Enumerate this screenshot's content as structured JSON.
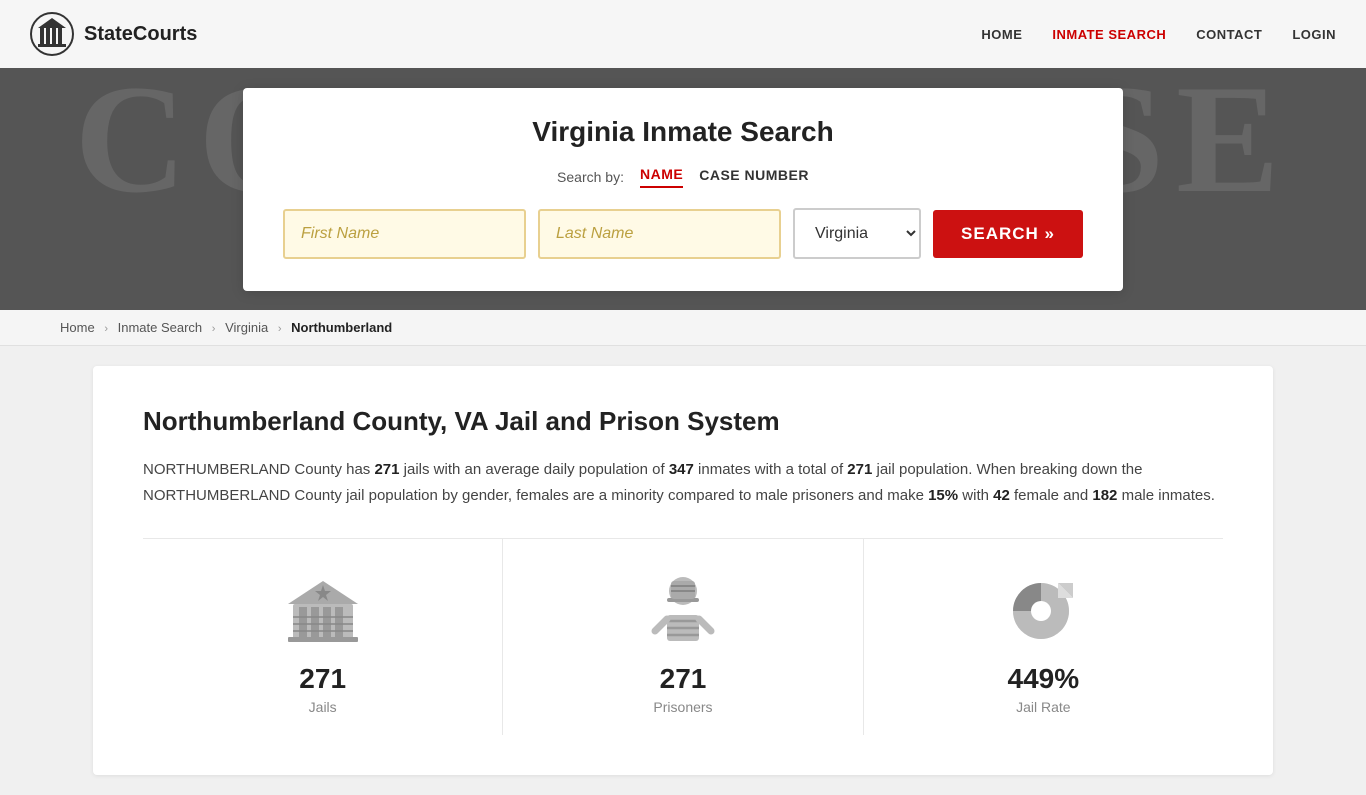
{
  "site": {
    "logo_text": "StateCourts",
    "bg_courthouse": "COURTHOUSE"
  },
  "nav": {
    "home": "HOME",
    "inmate_search": "INMATE SEARCH",
    "contact": "CONTACT",
    "login": "LOGIN"
  },
  "search_card": {
    "title": "Virginia Inmate Search",
    "search_by_label": "Search by:",
    "tab_name": "NAME",
    "tab_case": "CASE NUMBER",
    "first_name_placeholder": "First Name",
    "last_name_placeholder": "Last Name",
    "state_value": "Virginia",
    "search_btn": "SEARCH »"
  },
  "breadcrumb": {
    "home": "Home",
    "inmate_search": "Inmate Search",
    "state": "Virginia",
    "current": "Northumberland"
  },
  "content": {
    "county_title": "Northumberland County, VA Jail and Prison System",
    "description_1": " County has ",
    "jails_count": "271",
    "description_2": " jails with an average daily population of ",
    "avg_population": "347",
    "description_3": " inmates with a total of ",
    "total_jails": "271",
    "description_4": " jail population. When breaking down the NORTHUMBERLAND County jail population by gender, females are a minority compared to male prisoners and make ",
    "female_pct": "15%",
    "description_5": " with ",
    "female_count": "42",
    "description_6": " female and ",
    "male_count": "182",
    "description_7": " male inmates.",
    "county_upper": "NORTHUMBERLAND",
    "stats": [
      {
        "value": "271",
        "label": "Jails",
        "icon": "jails"
      },
      {
        "value": "271",
        "label": "Prisoners",
        "icon": "prisoners"
      },
      {
        "value": "449%",
        "label": "Jail Rate",
        "icon": "rate"
      }
    ]
  },
  "colors": {
    "red": "#cc1111",
    "gold_border": "#e8d090",
    "gold_bg": "#fffae6"
  }
}
